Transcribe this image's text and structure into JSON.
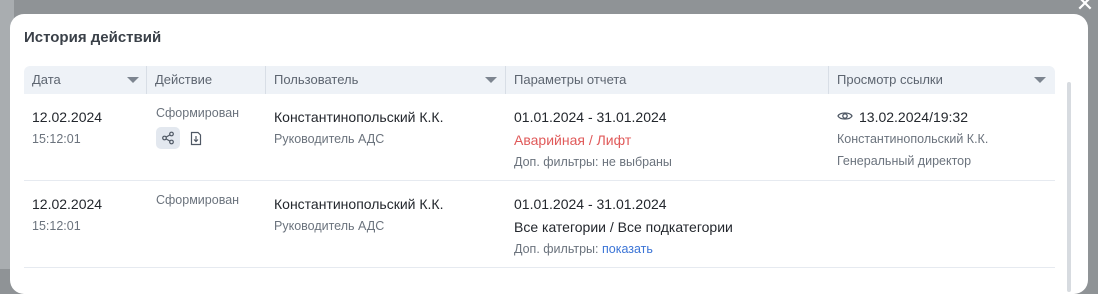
{
  "dialog": {
    "title": "История действий"
  },
  "table": {
    "columns": [
      {
        "label": "Дата",
        "has_filter": true
      },
      {
        "label": "Действие",
        "has_filter": false
      },
      {
        "label": "Пользователь",
        "has_filter": true
      },
      {
        "label": "Параметры отчета",
        "has_filter": false
      },
      {
        "label": "Просмотр ссылки",
        "has_filter": true
      }
    ],
    "rows": [
      {
        "date": "12.02.2024",
        "time": "15:12:01",
        "action": "Сформирован",
        "has_action_icons": true,
        "user_name": "Константинопольский К.К.",
        "user_role": "Руководитель АДС",
        "period": "01.01.2024 - 31.01.2024",
        "category": "Аварийная / Лифт",
        "filters_label": "Доп. фильтры:",
        "filters_value": "не выбраны",
        "view_datetime": "13.02.2024/19:32",
        "view_user": "Константинопольский К.К.",
        "view_role": "Генеральный директор"
      },
      {
        "date": "12.02.2024",
        "time": "15:12:01",
        "action": "Сформирован",
        "has_action_icons": false,
        "user_name": "Константинопольский К.К.",
        "user_role": "Руководитель АДС",
        "period": "01.01.2024 - 31.01.2024",
        "category": "Все категории / Все подкатегории",
        "filters_label": "Доп. фильтры:",
        "filters_link": "показать"
      }
    ]
  },
  "colors": {
    "header_bg": "#eef2f7",
    "alert_red": "#e05a5a",
    "link_blue": "#3b74d6"
  }
}
